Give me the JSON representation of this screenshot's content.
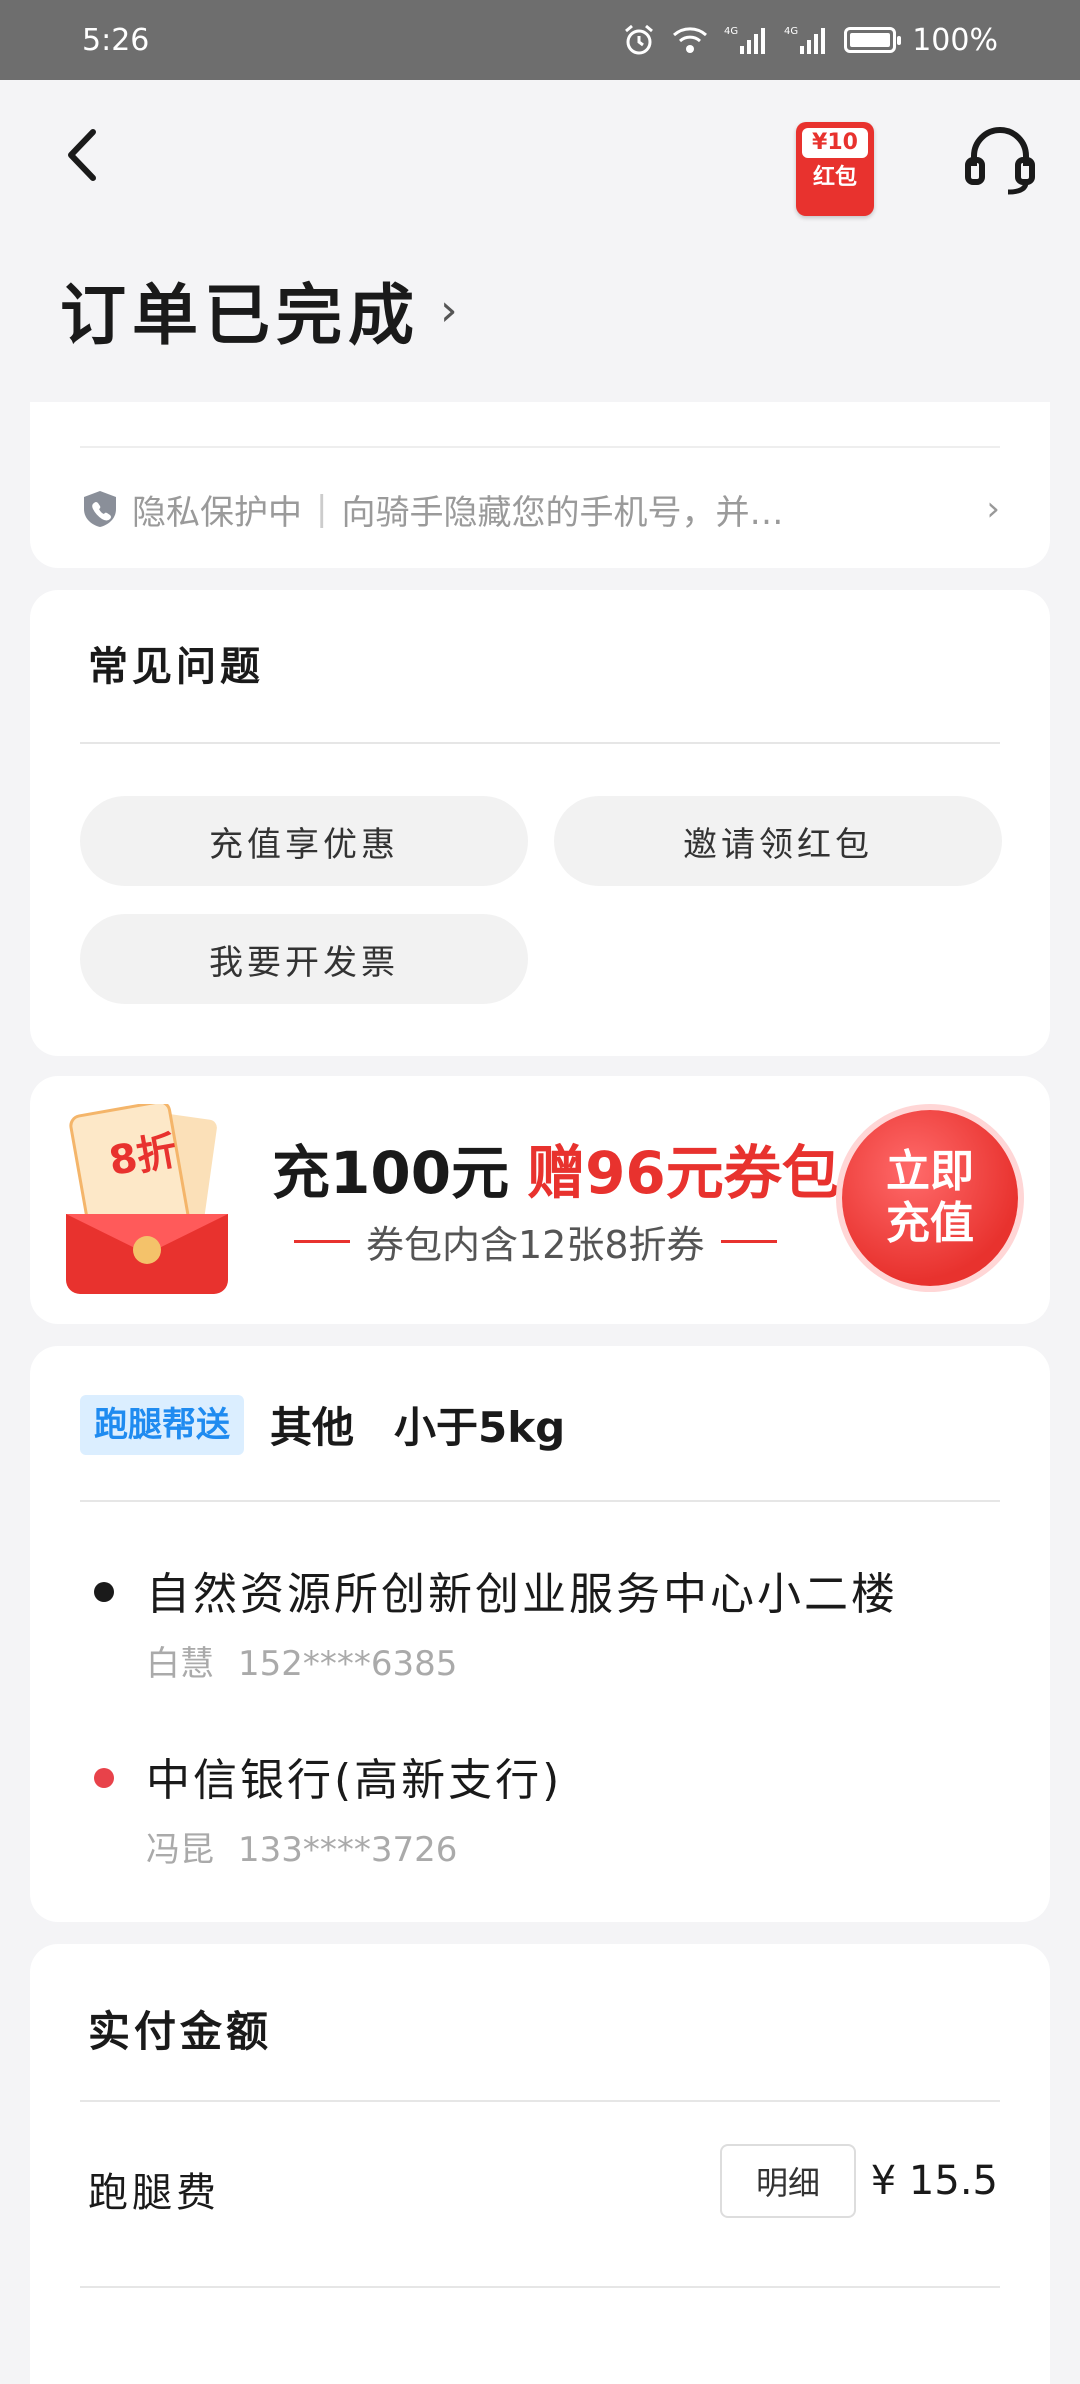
{
  "status_bar": {
    "time": "5:26",
    "battery_text": "100%",
    "battery_level": 1.0,
    "network_1": "4G",
    "network_2": "4G"
  },
  "header": {
    "redpacket_amount": "¥10",
    "redpacket_label": "红包"
  },
  "order": {
    "status_title": "订单已完成",
    "chevron": "›"
  },
  "privacy": {
    "label": "隐私保护中",
    "separator": "|",
    "text": "向骑手隐藏您的手机号，并…",
    "arrow": "›"
  },
  "faq": {
    "title": "常见问题",
    "items": [
      "充值享优惠",
      "邀请领红包",
      "我要开发票"
    ]
  },
  "promo": {
    "badge_text": "8折",
    "main_text": "充100元",
    "main_highlight": "赠96元券包",
    "sub_text": "券包内含12张8折券",
    "button_line1": "立即",
    "button_line2": "充值",
    "accent_color": "#e8322e"
  },
  "delivery": {
    "service_tag": "跑腿帮送",
    "category": "其他",
    "weight": "小于5kg",
    "addresses": [
      {
        "place": "自然资源所创新创业服务中心小二楼",
        "person": "白慧",
        "phone": "152****6385",
        "dot_color": "#1a1a1a"
      },
      {
        "place": "中信银行(高新支行)",
        "person": "冯昆",
        "phone": "133****3726",
        "dot_color": "#e8424a"
      }
    ]
  },
  "payment": {
    "title": "实付金额",
    "fee_label": "跑腿费",
    "detail_button": "明细",
    "fee_amount": "¥ 15.5"
  }
}
